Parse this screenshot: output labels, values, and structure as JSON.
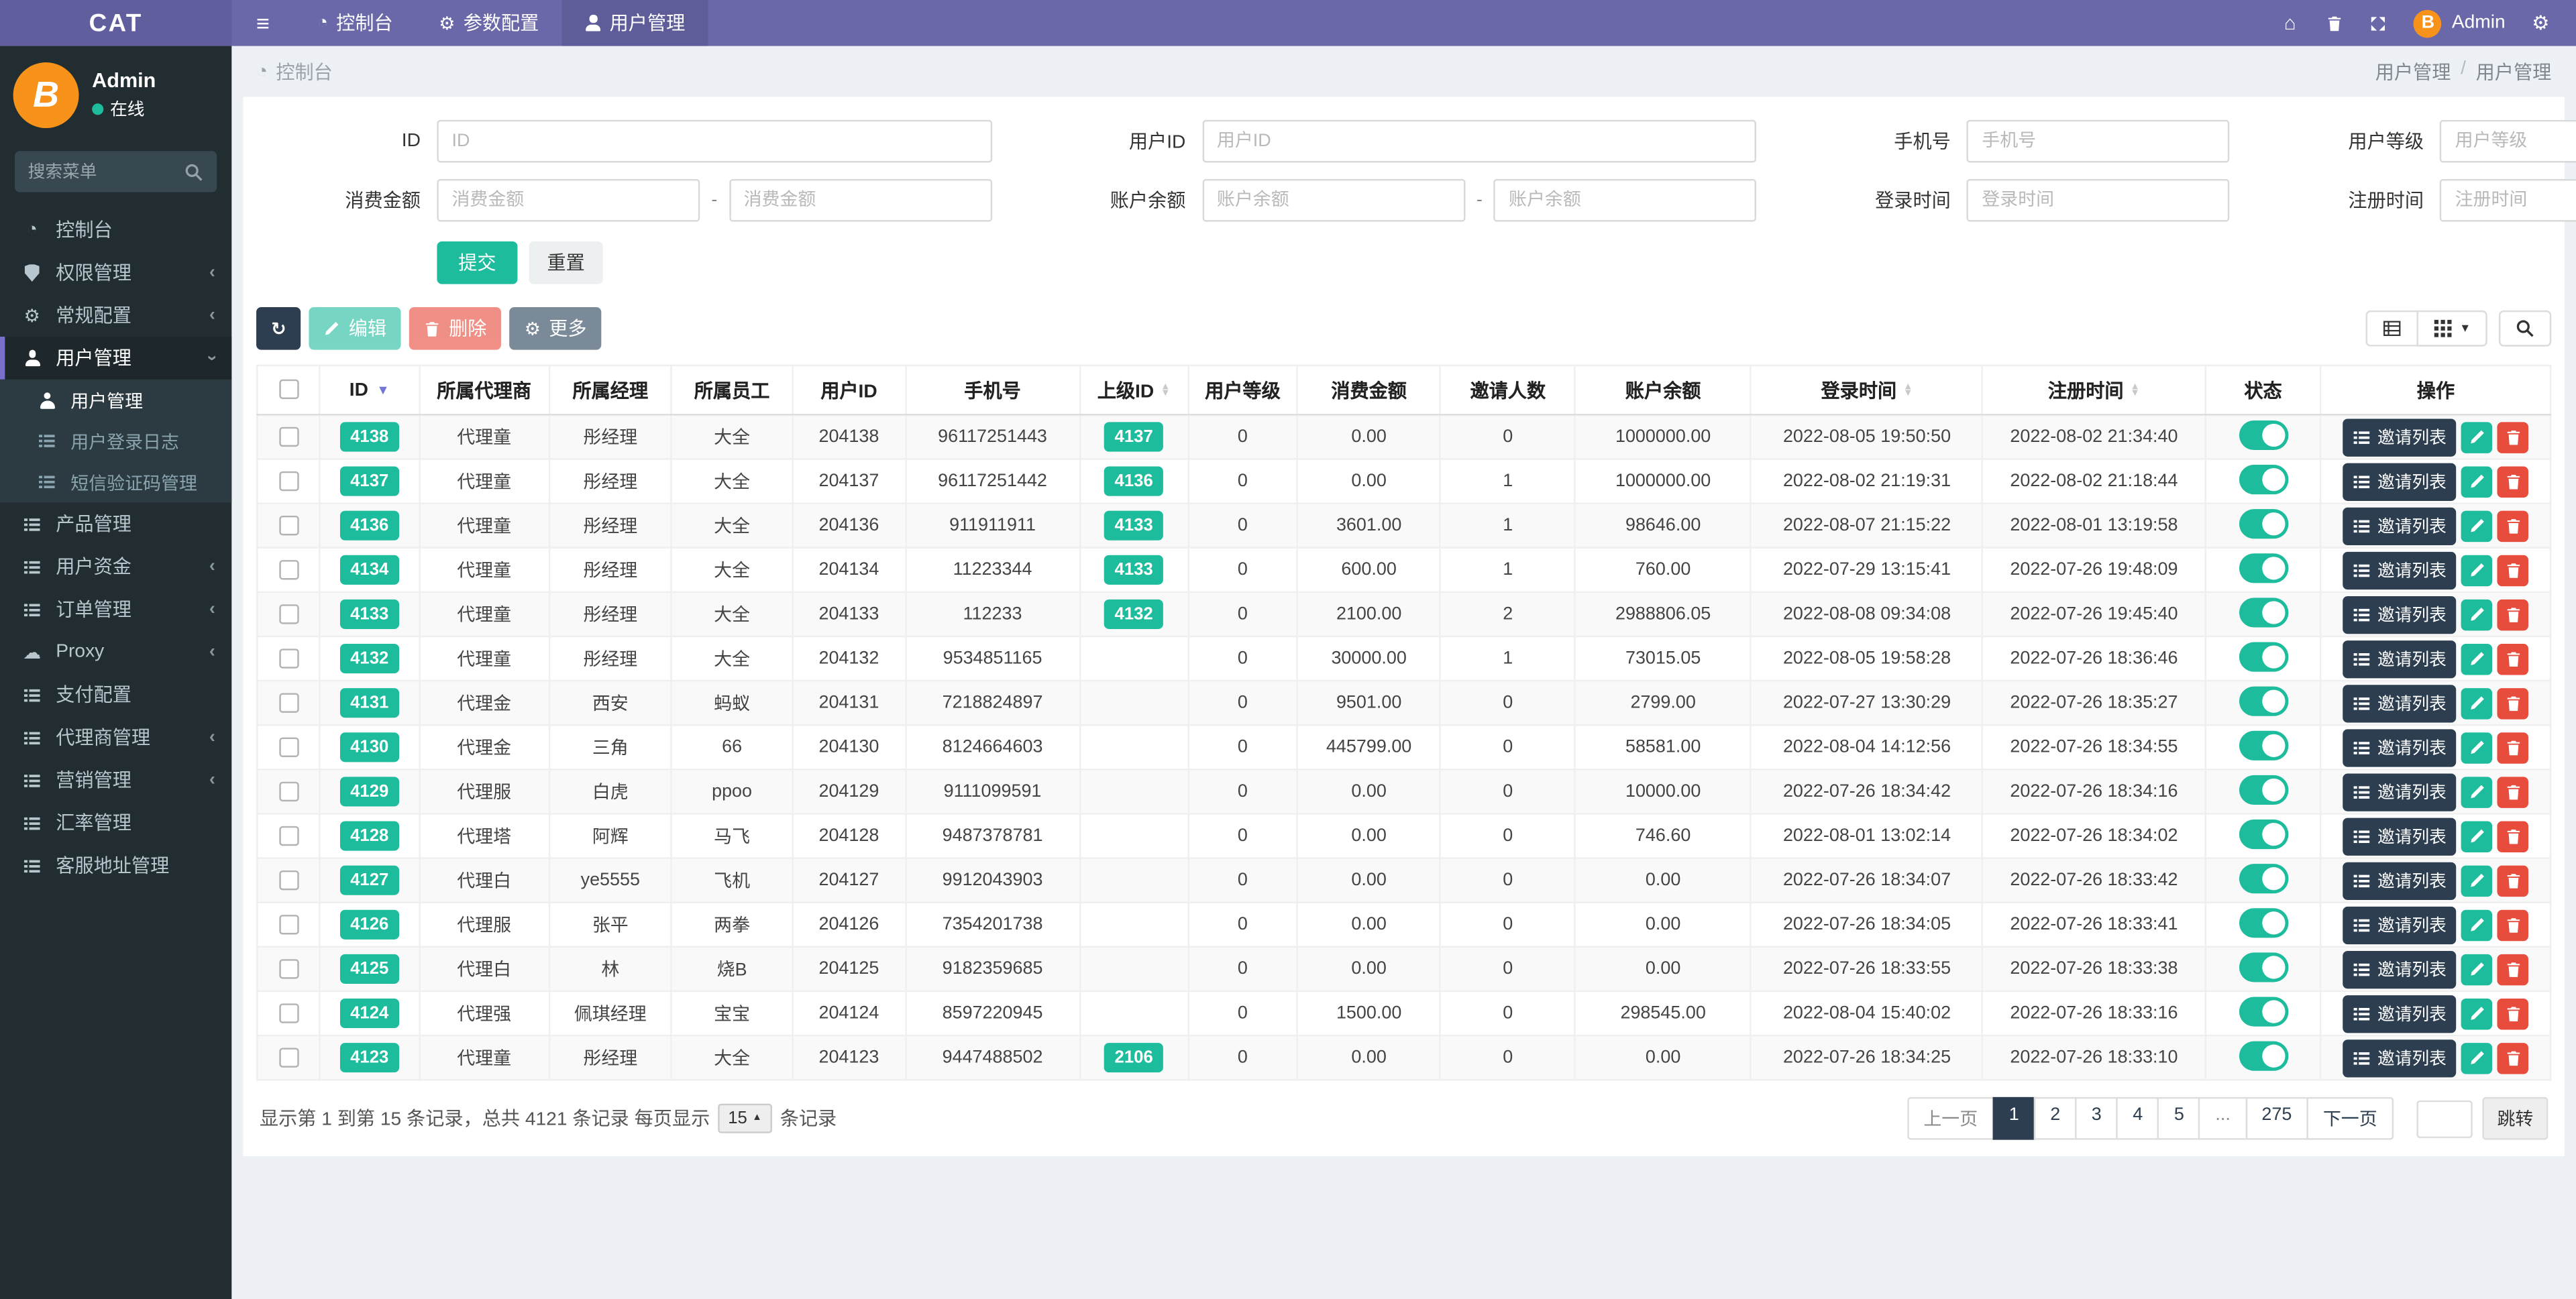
{
  "navbar": {
    "brand": "CAT",
    "items": [
      {
        "key": "dashboard",
        "label": "控制台",
        "icon": "dashboard",
        "active": false
      },
      {
        "key": "params-config",
        "label": "参数配置",
        "icon": "gear",
        "active": false
      },
      {
        "key": "user-management",
        "label": "用户管理",
        "icon": "person",
        "active": true
      }
    ],
    "user_name": "Admin"
  },
  "sidebar": {
    "user": {
      "name": "Admin",
      "status": "在线"
    },
    "search_placeholder": "搜索菜单",
    "menu": [
      {
        "key": "dashboard",
        "label": "控制台",
        "icon": "dashboard"
      },
      {
        "key": "permissions",
        "label": "权限管理",
        "icon": "shield",
        "arrow": "left"
      },
      {
        "key": "general-config",
        "label": "常规配置",
        "icon": "gear",
        "arrow": "left"
      },
      {
        "key": "user-management",
        "label": "用户管理",
        "icon": "person",
        "arrow": "down",
        "active": true,
        "sub": [
          {
            "key": "user-management",
            "label": "用户管理",
            "icon": "person",
            "active": true
          },
          {
            "key": "user-login-log",
            "label": "用户登录日志",
            "icon": "list",
            "active": false
          },
          {
            "key": "sms-code-management",
            "label": "短信验证码管理",
            "icon": "list",
            "active": false
          }
        ]
      },
      {
        "key": "product-management",
        "label": "产品管理",
        "icon": "list"
      },
      {
        "key": "user-funds",
        "label": "用户资金",
        "icon": "list",
        "arrow": "left"
      },
      {
        "key": "order-management",
        "label": "订单管理",
        "icon": "list",
        "arrow": "left"
      },
      {
        "key": "proxy",
        "label": "Proxy",
        "icon": "cloud",
        "arrow": "left"
      },
      {
        "key": "payment-config",
        "label": "支付配置",
        "icon": "list"
      },
      {
        "key": "agent-management",
        "label": "代理商管理",
        "icon": "list",
        "arrow": "left"
      },
      {
        "key": "marketing-management",
        "label": "营销管理",
        "icon": "list",
        "arrow": "left"
      },
      {
        "key": "exchange-rate-management",
        "label": "汇率管理",
        "icon": "list"
      },
      {
        "key": "support-address-management",
        "label": "客服地址管理",
        "icon": "list"
      }
    ]
  },
  "breadcrumb": {
    "section": "控制台",
    "trail": [
      "用户管理",
      "用户管理"
    ],
    "separator": "/"
  },
  "filters": {
    "fields": [
      {
        "key": "id",
        "label": "ID",
        "placeholder": "ID",
        "type": "single"
      },
      {
        "key": "user-id",
        "label": "用户ID",
        "placeholder": "用户ID",
        "type": "single"
      },
      {
        "key": "phone",
        "label": "手机号",
        "placeholder": "手机号",
        "type": "single"
      },
      {
        "key": "user-level",
        "label": "用户等级",
        "placeholder": "用户等级",
        "type": "single"
      },
      {
        "key": "consume-amount",
        "label": "消费金额",
        "placeholder": "消费金额",
        "type": "range"
      },
      {
        "key": "account-balance",
        "label": "账户余额",
        "placeholder": "账户余额",
        "type": "range"
      },
      {
        "key": "login-time",
        "label": "登录时间",
        "placeholder": "登录时间",
        "type": "single"
      },
      {
        "key": "register-time",
        "label": "注册时间",
        "placeholder": "注册时间",
        "type": "single"
      }
    ],
    "range_separator": "-",
    "submit_label": "提交",
    "reset_label": "重置"
  },
  "toolbar": {
    "buttons": [
      {
        "key": "refresh",
        "label": "",
        "icon": "refresh",
        "style": "dark"
      },
      {
        "key": "edit",
        "label": "编辑",
        "icon": "pencil",
        "style": "green"
      },
      {
        "key": "delete",
        "label": "删除",
        "icon": "trash",
        "style": "red"
      },
      {
        "key": "more",
        "label": "更多",
        "icon": "gear",
        "style": "gray"
      }
    ],
    "view_buttons": [
      {
        "key": "toggle-pagination",
        "icon": "table"
      },
      {
        "key": "columns",
        "icon": "grid",
        "caret": true
      },
      {
        "key": "search",
        "icon": "search"
      }
    ]
  },
  "table": {
    "columns": [
      {
        "key": "checkbox",
        "label": "",
        "type": "checkbox",
        "width": "2.7%"
      },
      {
        "key": "id",
        "label": "ID",
        "sort": "desc",
        "width": "4.3%"
      },
      {
        "key": "agent",
        "label": "所属代理商",
        "width": "5.6%"
      },
      {
        "key": "manager",
        "label": "所属经理",
        "width": "5.3%"
      },
      {
        "key": "staff",
        "label": "所属员工",
        "width": "5.2%"
      },
      {
        "key": "user-id",
        "label": "用户ID",
        "width": "4.9%"
      },
      {
        "key": "phone",
        "label": "手机号",
        "width": "7.5%"
      },
      {
        "key": "parent-id",
        "label": "上级ID",
        "sort": "both",
        "width": "4.7%"
      },
      {
        "key": "user-level",
        "label": "用户等级",
        "width": "4.7%"
      },
      {
        "key": "consume-amount",
        "label": "消费金额",
        "width": "6.2%"
      },
      {
        "key": "invite-count",
        "label": "邀请人数",
        "width": "5.8%"
      },
      {
        "key": "account-balance",
        "label": "账户余额",
        "width": "7.6%"
      },
      {
        "key": "login-time",
        "label": "登录时间",
        "sort": "both",
        "width": "10.0%"
      },
      {
        "key": "register-time",
        "label": "注册时间",
        "sort": "both",
        "width": "9.6%"
      },
      {
        "key": "status",
        "label": "状态",
        "width": "5.0%"
      },
      {
        "key": "actions",
        "label": "操作",
        "width": "9.9%"
      }
    ],
    "invite_button_label": "邀请列表",
    "rows": [
      {
        "id": "4138",
        "agent": "代理童",
        "manager": "彤经理",
        "staff": "大全",
        "uid": "204138",
        "phone": "96117251443",
        "parent": "4137",
        "level": "0",
        "consume": "0.00",
        "invites": "0",
        "balance": "1000000.00",
        "login": "2022-08-05 19:50:50",
        "reg": "2022-08-02 21:34:40",
        "status": true
      },
      {
        "id": "4137",
        "agent": "代理童",
        "manager": "彤经理",
        "staff": "大全",
        "uid": "204137",
        "phone": "96117251442",
        "parent": "4136",
        "level": "0",
        "consume": "0.00",
        "invites": "1",
        "balance": "1000000.00",
        "login": "2022-08-02 21:19:31",
        "reg": "2022-08-02 21:18:44",
        "status": true
      },
      {
        "id": "4136",
        "agent": "代理童",
        "manager": "彤经理",
        "staff": "大全",
        "uid": "204136",
        "phone": "911911911",
        "parent": "4133",
        "level": "0",
        "consume": "3601.00",
        "invites": "1",
        "balance": "98646.00",
        "login": "2022-08-07 21:15:22",
        "reg": "2022-08-01 13:19:58",
        "status": true
      },
      {
        "id": "4134",
        "agent": "代理童",
        "manager": "彤经理",
        "staff": "大全",
        "uid": "204134",
        "phone": "11223344",
        "parent": "4133",
        "level": "0",
        "consume": "600.00",
        "invites": "1",
        "balance": "760.00",
        "login": "2022-07-29 13:15:41",
        "reg": "2022-07-26 19:48:09",
        "status": true
      },
      {
        "id": "4133",
        "agent": "代理童",
        "manager": "彤经理",
        "staff": "大全",
        "uid": "204133",
        "phone": "112233",
        "parent": "4132",
        "level": "0",
        "consume": "2100.00",
        "invites": "2",
        "balance": "2988806.05",
        "login": "2022-08-08 09:34:08",
        "reg": "2022-07-26 19:45:40",
        "status": true
      },
      {
        "id": "4132",
        "agent": "代理童",
        "manager": "彤经理",
        "staff": "大全",
        "uid": "204132",
        "phone": "9534851165",
        "parent": "",
        "level": "0",
        "consume": "30000.00",
        "invites": "1",
        "balance": "73015.05",
        "login": "2022-08-05 19:58:28",
        "reg": "2022-07-26 18:36:46",
        "status": true
      },
      {
        "id": "4131",
        "agent": "代理金",
        "manager": "西安",
        "staff": "蚂蚁",
        "uid": "204131",
        "phone": "7218824897",
        "parent": "",
        "level": "0",
        "consume": "9501.00",
        "invites": "0",
        "balance": "2799.00",
        "login": "2022-07-27 13:30:29",
        "reg": "2022-07-26 18:35:27",
        "status": true
      },
      {
        "id": "4130",
        "agent": "代理金",
        "manager": "三角",
        "staff": "66",
        "uid": "204130",
        "phone": "8124664603",
        "parent": "",
        "level": "0",
        "consume": "445799.00",
        "invites": "0",
        "balance": "58581.00",
        "login": "2022-08-04 14:12:56",
        "reg": "2022-07-26 18:34:55",
        "status": true
      },
      {
        "id": "4129",
        "agent": "代理服",
        "manager": "白虎",
        "staff": "ppoo",
        "uid": "204129",
        "phone": "9111099591",
        "parent": "",
        "level": "0",
        "consume": "0.00",
        "invites": "0",
        "balance": "10000.00",
        "login": "2022-07-26 18:34:42",
        "reg": "2022-07-26 18:34:16",
        "status": true
      },
      {
        "id": "4128",
        "agent": "代理塔",
        "manager": "阿辉",
        "staff": "马飞",
        "uid": "204128",
        "phone": "9487378781",
        "parent": "",
        "level": "0",
        "consume": "0.00",
        "invites": "0",
        "balance": "746.60",
        "login": "2022-08-01 13:02:14",
        "reg": "2022-07-26 18:34:02",
        "status": true
      },
      {
        "id": "4127",
        "agent": "代理白",
        "manager": "ye5555",
        "staff": "飞机",
        "uid": "204127",
        "phone": "9912043903",
        "parent": "",
        "level": "0",
        "consume": "0.00",
        "invites": "0",
        "balance": "0.00",
        "login": "2022-07-26 18:34:07",
        "reg": "2022-07-26 18:33:42",
        "status": true
      },
      {
        "id": "4126",
        "agent": "代理服",
        "manager": "张平",
        "staff": "两拳",
        "uid": "204126",
        "phone": "7354201738",
        "parent": "",
        "level": "0",
        "consume": "0.00",
        "invites": "0",
        "balance": "0.00",
        "login": "2022-07-26 18:34:05",
        "reg": "2022-07-26 18:33:41",
        "status": true
      },
      {
        "id": "4125",
        "agent": "代理白",
        "manager": "林",
        "staff": "烧B",
        "uid": "204125",
        "phone": "9182359685",
        "parent": "",
        "level": "0",
        "consume": "0.00",
        "invites": "0",
        "balance": "0.00",
        "login": "2022-07-26 18:33:55",
        "reg": "2022-07-26 18:33:38",
        "status": true
      },
      {
        "id": "4124",
        "agent": "代理强",
        "manager": "佩琪经理",
        "staff": "宝宝",
        "uid": "204124",
        "phone": "8597220945",
        "parent": "",
        "level": "0",
        "consume": "1500.00",
        "invites": "0",
        "balance": "298545.00",
        "login": "2022-08-04 15:40:02",
        "reg": "2022-07-26 18:33:16",
        "status": true
      },
      {
        "id": "4123",
        "agent": "代理童",
        "manager": "彤经理",
        "staff": "大全",
        "uid": "204123",
        "phone": "9447488502",
        "parent": "2106",
        "level": "0",
        "consume": "0.00",
        "invites": "0",
        "balance": "0.00",
        "login": "2022-07-26 18:34:25",
        "reg": "2022-07-26 18:33:10",
        "status": true
      }
    ]
  },
  "footer": {
    "summary_prefix": "显示第 1 到第 15 条记录，总共 4121 条记录 每页显示",
    "page_size": "15",
    "summary_suffix": "条记录",
    "pages": [
      "上一页",
      "1",
      "2",
      "3",
      "4",
      "5",
      "...",
      "275",
      "下一页"
    ],
    "active_page": "1",
    "jump_label": "跳转"
  },
  "colors": {
    "navbar": "#6b68a9",
    "navbar_brand": "#615e9e",
    "sidebar": "#222d32",
    "accent_green": "#1dbc9c",
    "accent_dark": "#2c3e50",
    "accent_red": "#e74c3c",
    "bitcoin_orange": "#f7931a",
    "content_bg": "#edf0f5"
  }
}
